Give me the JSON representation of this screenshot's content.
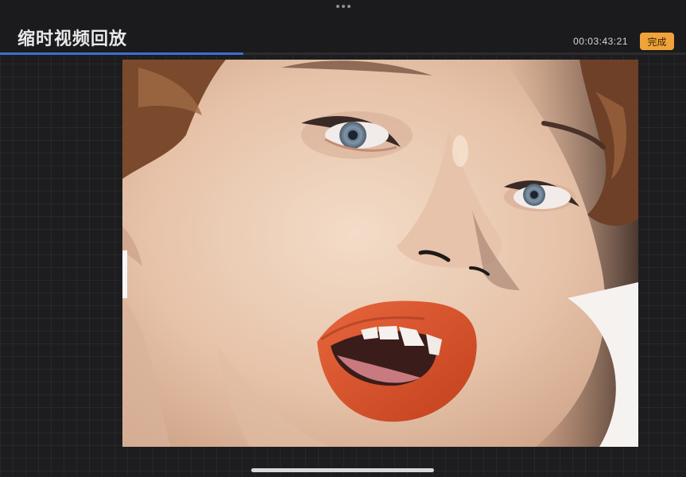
{
  "app": {
    "title": "缩时视频回放",
    "timecode": "00:03:43:21",
    "done_label": "完成"
  },
  "playback": {
    "progress_fraction": 0.355
  },
  "canvas": {
    "subject": "digital painting portrait"
  },
  "colors": {
    "accent": "#f0a33a",
    "progress": "#3e6fd0",
    "background": "#1d1d1f"
  },
  "icons": {
    "top_center": "multitask-dots-icon"
  }
}
